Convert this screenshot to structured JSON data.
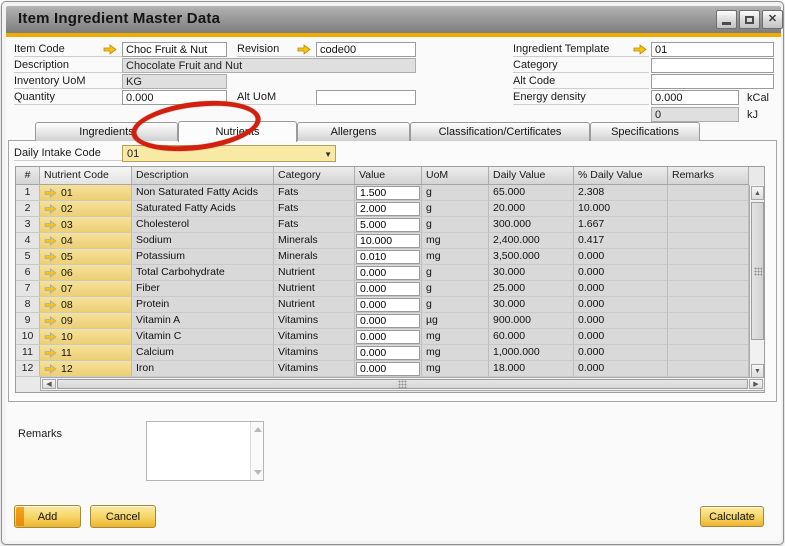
{
  "window": {
    "title": "Item Ingredient Master Data",
    "close_glyph": "✕"
  },
  "form": {
    "item_code": {
      "label": "Item Code",
      "value": "Choc Fruit & Nut"
    },
    "revision": {
      "label": "Revision",
      "value": "code00"
    },
    "ingredient_template": {
      "label": "Ingredient Template",
      "value": "01"
    },
    "description": {
      "label": "Description",
      "value": "Chocolate Fruit and Nut"
    },
    "category": {
      "label": "Category",
      "value": ""
    },
    "inventory_uom": {
      "label": "Inventory UoM",
      "value": "KG"
    },
    "alt_code": {
      "label": "Alt Code",
      "value": ""
    },
    "quantity": {
      "label": "Quantity",
      "value": "0.000"
    },
    "alt_uom": {
      "label": "Alt UoM",
      "value": ""
    },
    "energy_density": {
      "label": "Energy density",
      "value_kcal": "0.000",
      "unit_kcal": "kCal",
      "value_kj": "0",
      "unit_kj": "kJ"
    }
  },
  "tabs": [
    {
      "label": "Ingredients",
      "active": false
    },
    {
      "label": "Nutrients",
      "active": true
    },
    {
      "label": "Allergens",
      "active": false
    },
    {
      "label": "Classification/Certificates",
      "active": false
    },
    {
      "label": "Specifications",
      "active": false
    }
  ],
  "nutrients_panel": {
    "daily_intake": {
      "label": "Daily Intake Code",
      "value": "01"
    }
  },
  "table": {
    "columns": [
      "#",
      "Nutrient Code",
      "Description",
      "Category",
      "Value",
      "UoM",
      "Daily Value",
      "% Daily Value",
      "Remarks"
    ],
    "rows": [
      {
        "num": "1",
        "code": "01",
        "description": "Non Saturated Fatty Acids",
        "category": "Fats",
        "value": "1.500",
        "uom": "g",
        "daily_value": "65.000",
        "pct_daily_value": "2.308",
        "remarks": ""
      },
      {
        "num": "2",
        "code": "02",
        "description": "Saturated Fatty Acids",
        "category": "Fats",
        "value": "2.000",
        "uom": "g",
        "daily_value": "20.000",
        "pct_daily_value": "10.000",
        "remarks": ""
      },
      {
        "num": "3",
        "code": "03",
        "description": "Cholesterol",
        "category": "Fats",
        "value": "5.000",
        "uom": "g",
        "daily_value": "300.000",
        "pct_daily_value": "1.667",
        "remarks": ""
      },
      {
        "num": "4",
        "code": "04",
        "description": "Sodium",
        "category": "Minerals",
        "value": "10.000",
        "uom": "mg",
        "daily_value": "2,400.000",
        "pct_daily_value": "0.417",
        "remarks": ""
      },
      {
        "num": "5",
        "code": "05",
        "description": "Potassium",
        "category": "Minerals",
        "value": "0.010",
        "uom": "mg",
        "daily_value": "3,500.000",
        "pct_daily_value": "0.000",
        "remarks": ""
      },
      {
        "num": "6",
        "code": "06",
        "description": "Total Carbohydrate",
        "category": "Nutrient",
        "value": "0.000",
        "uom": "g",
        "daily_value": "30.000",
        "pct_daily_value": "0.000",
        "remarks": ""
      },
      {
        "num": "7",
        "code": "07",
        "description": "Fiber",
        "category": "Nutrient",
        "value": "0.000",
        "uom": "g",
        "daily_value": "25.000",
        "pct_daily_value": "0.000",
        "remarks": ""
      },
      {
        "num": "8",
        "code": "08",
        "description": "Protein",
        "category": "Nutrient",
        "value": "0.000",
        "uom": "g",
        "daily_value": "30.000",
        "pct_daily_value": "0.000",
        "remarks": ""
      },
      {
        "num": "9",
        "code": "09",
        "description": "Vitamin A",
        "category": "Vitamins",
        "value": "0.000",
        "uom": "µg",
        "daily_value": "900.000",
        "pct_daily_value": "0.000",
        "remarks": ""
      },
      {
        "num": "10",
        "code": "10",
        "description": "Vitamin C",
        "category": "Vitamins",
        "value": "0.000",
        "uom": "mg",
        "daily_value": "60.000",
        "pct_daily_value": "0.000",
        "remarks": ""
      },
      {
        "num": "11",
        "code": "11",
        "description": "Calcium",
        "category": "Vitamins",
        "value": "0.000",
        "uom": "mg",
        "daily_value": "1,000.000",
        "pct_daily_value": "0.000",
        "remarks": ""
      },
      {
        "num": "12",
        "code": "12",
        "description": "Iron",
        "category": "Vitamins",
        "value": "0.000",
        "uom": "mg",
        "daily_value": "18.000",
        "pct_daily_value": "0.000",
        "remarks": ""
      }
    ]
  },
  "remarks": {
    "label": "Remarks",
    "value": ""
  },
  "buttons": {
    "add": "Add",
    "cancel": "Cancel",
    "calculate": "Calculate"
  },
  "annotation": {
    "shape": "red-ellipse",
    "target": "Nutrients tab"
  },
  "colors": {
    "accent_gold": "#F0AB00",
    "code_cell_yellow": "#F3DC8E",
    "annotation_red": "#D2200F",
    "button_yellow": "#F6D766"
  }
}
